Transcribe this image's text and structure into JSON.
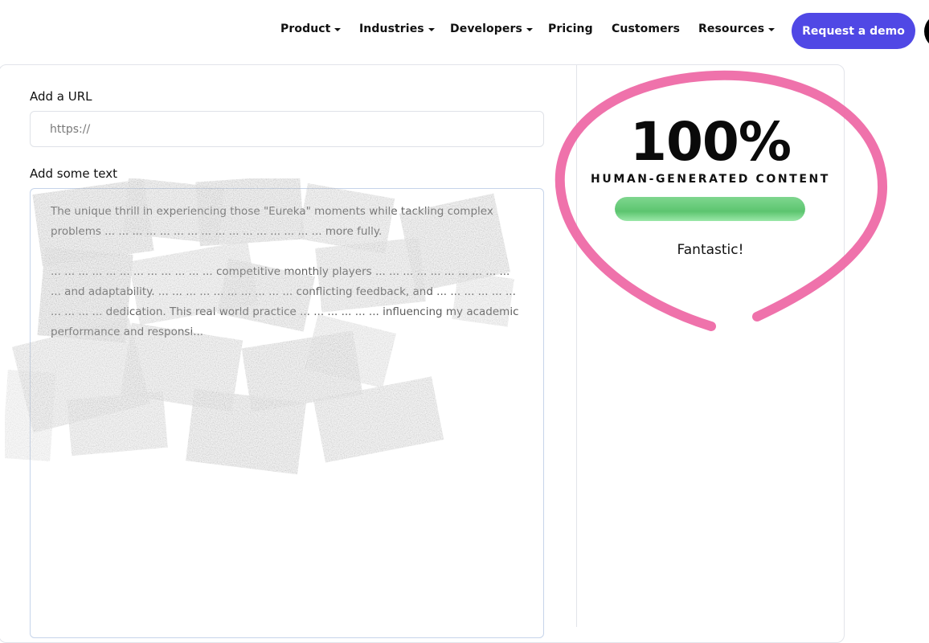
{
  "nav": {
    "items": [
      {
        "label": "Product",
        "dropdown": true
      },
      {
        "label": "Industries",
        "dropdown": true
      },
      {
        "label": "Developers",
        "dropdown": true
      },
      {
        "label": "Pricing",
        "dropdown": false
      },
      {
        "label": "Customers",
        "dropdown": false
      },
      {
        "label": "Resources",
        "dropdown": true
      }
    ],
    "demo_button": "Request a demo",
    "accent_color": "#5048e5"
  },
  "form": {
    "url_label": "Add a URL",
    "url_placeholder": "https://",
    "text_label": "Add some text",
    "text_paragraphs": [
      "The unique thrill in experiencing those \"Eureka\" moments while tackling complex problems ... ... ... ... ... ... ... ... ... ... ... ... ... ... ... ... more fully.",
      "... ... ... ... ... ... ... ... ... ... ... ... competitive monthly players ... ... ... ... ... ... ... ... ... ... ... and adaptability. ... ... ... ... ... ... ... ... ... ... conflicting feedback, and ... ... ... ... ... ... ... ... ... ... dedication. This real world practice ... ... ... ... ... ... influencing my academic performance and responsi..."
    ]
  },
  "result": {
    "score": "100%",
    "label": "HUMAN-GENERATED CONTENT",
    "progress": 1.0,
    "verdict": "Fantastic!",
    "bar_color": "#5cc56f",
    "circle_color": "#ee6aa7"
  }
}
